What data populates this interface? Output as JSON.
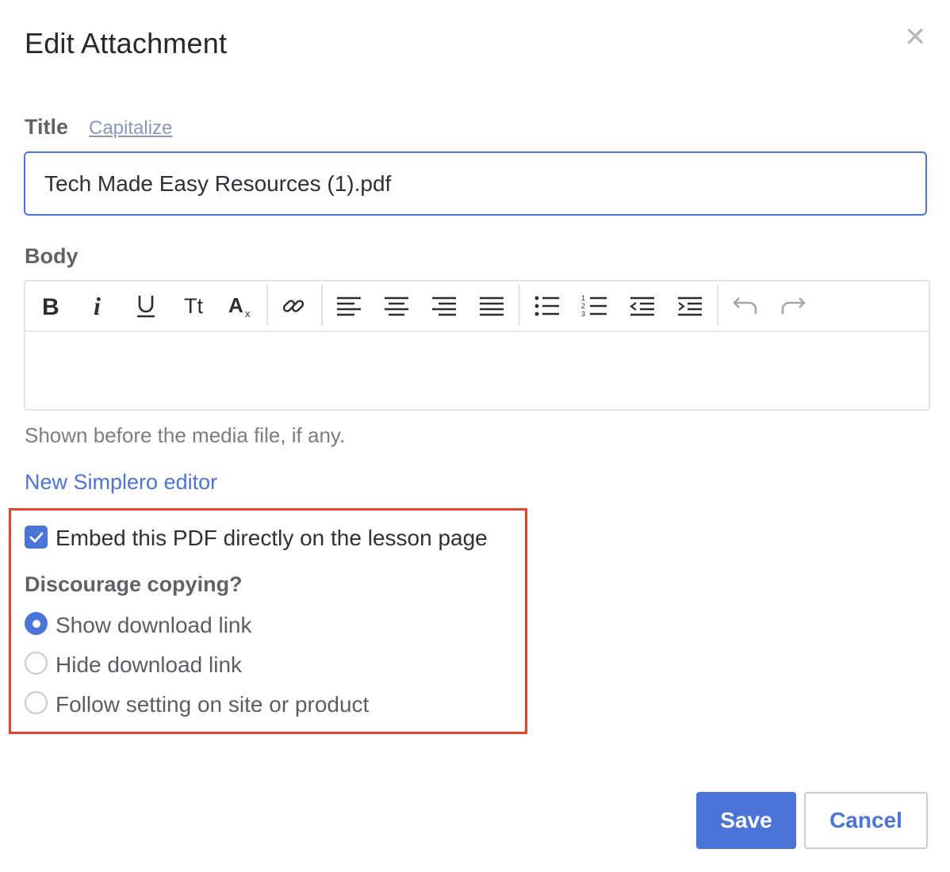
{
  "dialog": {
    "title": "Edit Attachment",
    "close_icon": "close-icon"
  },
  "title_field": {
    "label": "Title",
    "capitalize_link": "Capitalize",
    "value": "Tech Made Easy Resources (1).pdf"
  },
  "body_field": {
    "label": "Body",
    "toolbar": {
      "buttons": [
        {
          "icon": "bold-icon"
        },
        {
          "icon": "italic-icon"
        },
        {
          "icon": "underline-icon"
        },
        {
          "icon": "text-size-icon",
          "text": "Tt"
        },
        {
          "icon": "clear-format-icon"
        },
        {
          "icon": "link-icon"
        },
        {
          "icon": "align-left-icon"
        },
        {
          "icon": "align-center-icon"
        },
        {
          "icon": "align-right-icon"
        },
        {
          "icon": "align-justify-icon"
        },
        {
          "icon": "bullet-list-icon"
        },
        {
          "icon": "numbered-list-icon"
        },
        {
          "icon": "outdent-icon"
        },
        {
          "icon": "indent-icon"
        },
        {
          "icon": "undo-icon"
        },
        {
          "icon": "redo-icon"
        }
      ]
    },
    "content": "",
    "helper_text": "Shown before the media file, if any."
  },
  "editor_link": "New Simplero editor",
  "embed": {
    "label": "Embed this PDF directly on the lesson page",
    "checked": true
  },
  "discourage": {
    "label": "Discourage copying?",
    "options": [
      {
        "label": "Show download link",
        "selected": true
      },
      {
        "label": "Hide download link",
        "selected": false
      },
      {
        "label": "Follow setting on site or product",
        "selected": false
      }
    ]
  },
  "actions": {
    "save_label": "Save",
    "cancel_label": "Cancel"
  },
  "colors": {
    "accent": "#4b74d9",
    "highlight_border": "#e3432c",
    "muted_label": "#5f6369"
  }
}
